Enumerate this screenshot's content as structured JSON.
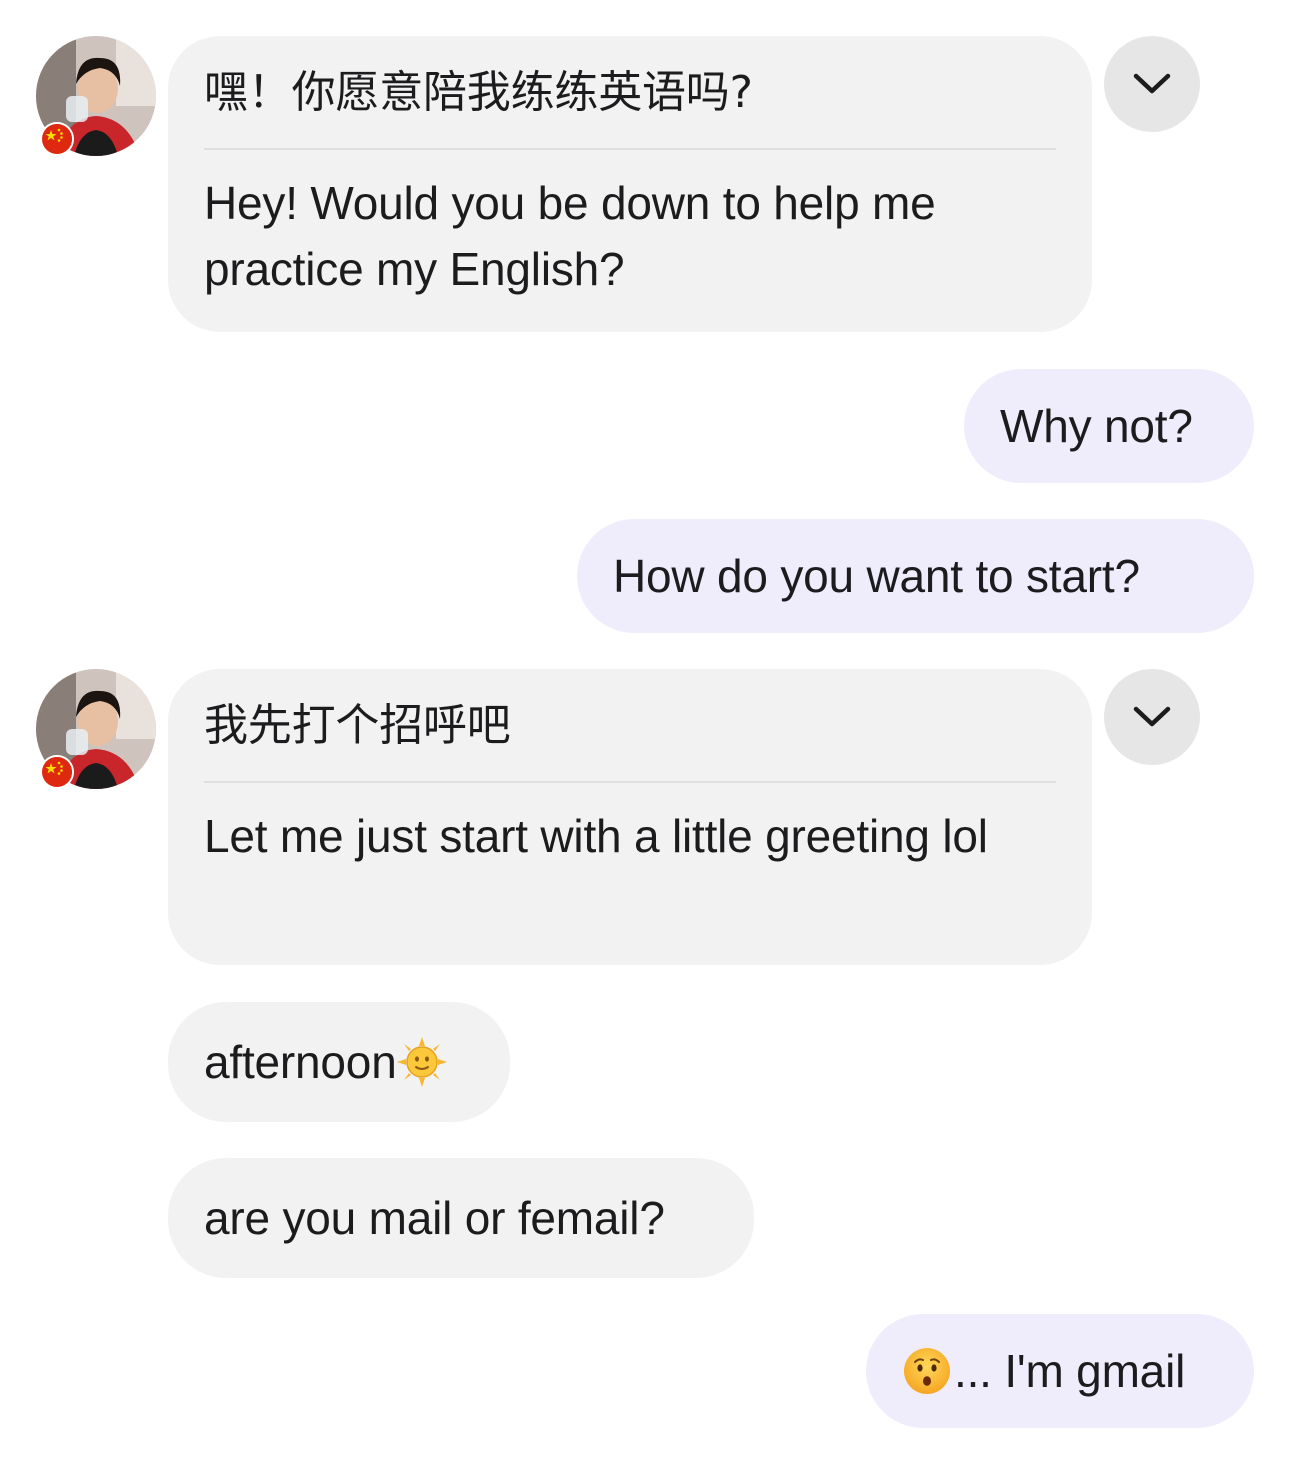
{
  "messages": [
    {
      "direction": "incoming",
      "original": "嘿！你愿意陪我练练英语吗?",
      "translation": "Hey! Would you be down to help me practice my English?"
    },
    {
      "direction": "outgoing",
      "text": "Why not?"
    },
    {
      "direction": "outgoing",
      "text": "How do you want to start?"
    },
    {
      "direction": "incoming",
      "original": "我先打个招呼吧",
      "translation": "Let me just start with a little greeting lol"
    },
    {
      "direction": "incoming",
      "text": "afternoon",
      "emoji": "sun-with-face-emoji"
    },
    {
      "direction": "incoming",
      "text": "are you mail or femail?"
    },
    {
      "direction": "outgoing",
      "emoji": "hushed-face-emoji",
      "text": "... I'm gmail"
    }
  ],
  "icons": {
    "expand": "chevron-down-icon",
    "flag": "china-flag-icon"
  },
  "colors": {
    "incoming_bubble": "#f2f2f2",
    "outgoing_bubble": "#efedfc",
    "chevron_button": "#e6e6e6",
    "text": "#1c1c1e"
  }
}
